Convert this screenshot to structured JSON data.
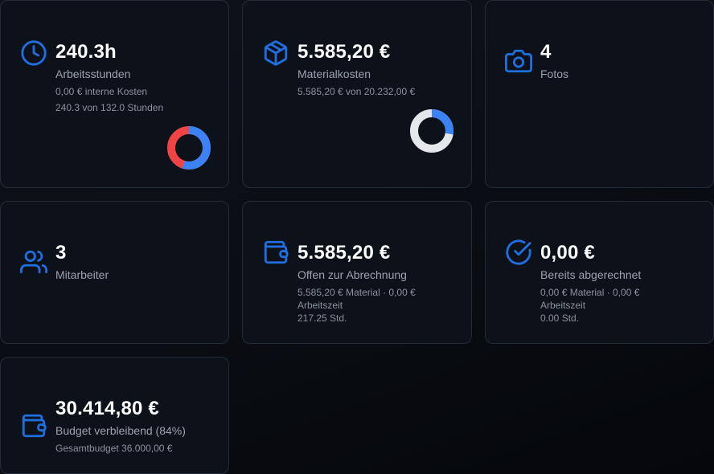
{
  "colors": {
    "accent": "#3b82f6",
    "icon": "#1f6fe0",
    "danger": "#ef4444",
    "ring_bg": "#e5e7eb",
    "card_bg": "#0d121a",
    "card_border": "#242c38"
  },
  "cards": {
    "hours": {
      "icon": "clock-icon",
      "value": "240.3h",
      "label": "Arbeitsstunden",
      "sub1": "0,00 € interne Kosten",
      "sub2": "240.3 von 132.0 Stunden",
      "donut": {
        "primary_fraction": 0.55,
        "primary_color": "#3b82f6",
        "rest_color": "#ef4444"
      }
    },
    "material": {
      "icon": "package-icon",
      "value": "5.585,20 €",
      "label": "Materialkosten",
      "sub1": "5.585,20 € von 20.232,00 €",
      "donut": {
        "primary_fraction": 0.276,
        "primary_color": "#3b82f6",
        "rest_color": "#e5e7eb"
      }
    },
    "photos": {
      "icon": "camera-icon",
      "value": "4",
      "label": "Fotos"
    },
    "staff": {
      "icon": "users-icon",
      "value": "3",
      "label": "Mitarbeiter"
    },
    "open": {
      "icon": "wallet-icon",
      "value": "5.585,20 €",
      "label": "Offen zur Abrechnung",
      "sub1": "5.585,20 € Material · 0,00 € Arbeitszeit",
      "sub2": "217.25 Std."
    },
    "billed": {
      "icon": "check-circle-icon",
      "value": "0,00 €",
      "label": "Bereits abgerechnet",
      "sub1": "0,00 € Material · 0,00 € Arbeitszeit",
      "sub2": "0.00 Std."
    },
    "budget": {
      "icon": "wallet-icon",
      "value": "30.414,80 €",
      "label": "Budget verbleibend (84%)",
      "sub1": "Gesamtbudget 36.000,00 €"
    }
  }
}
